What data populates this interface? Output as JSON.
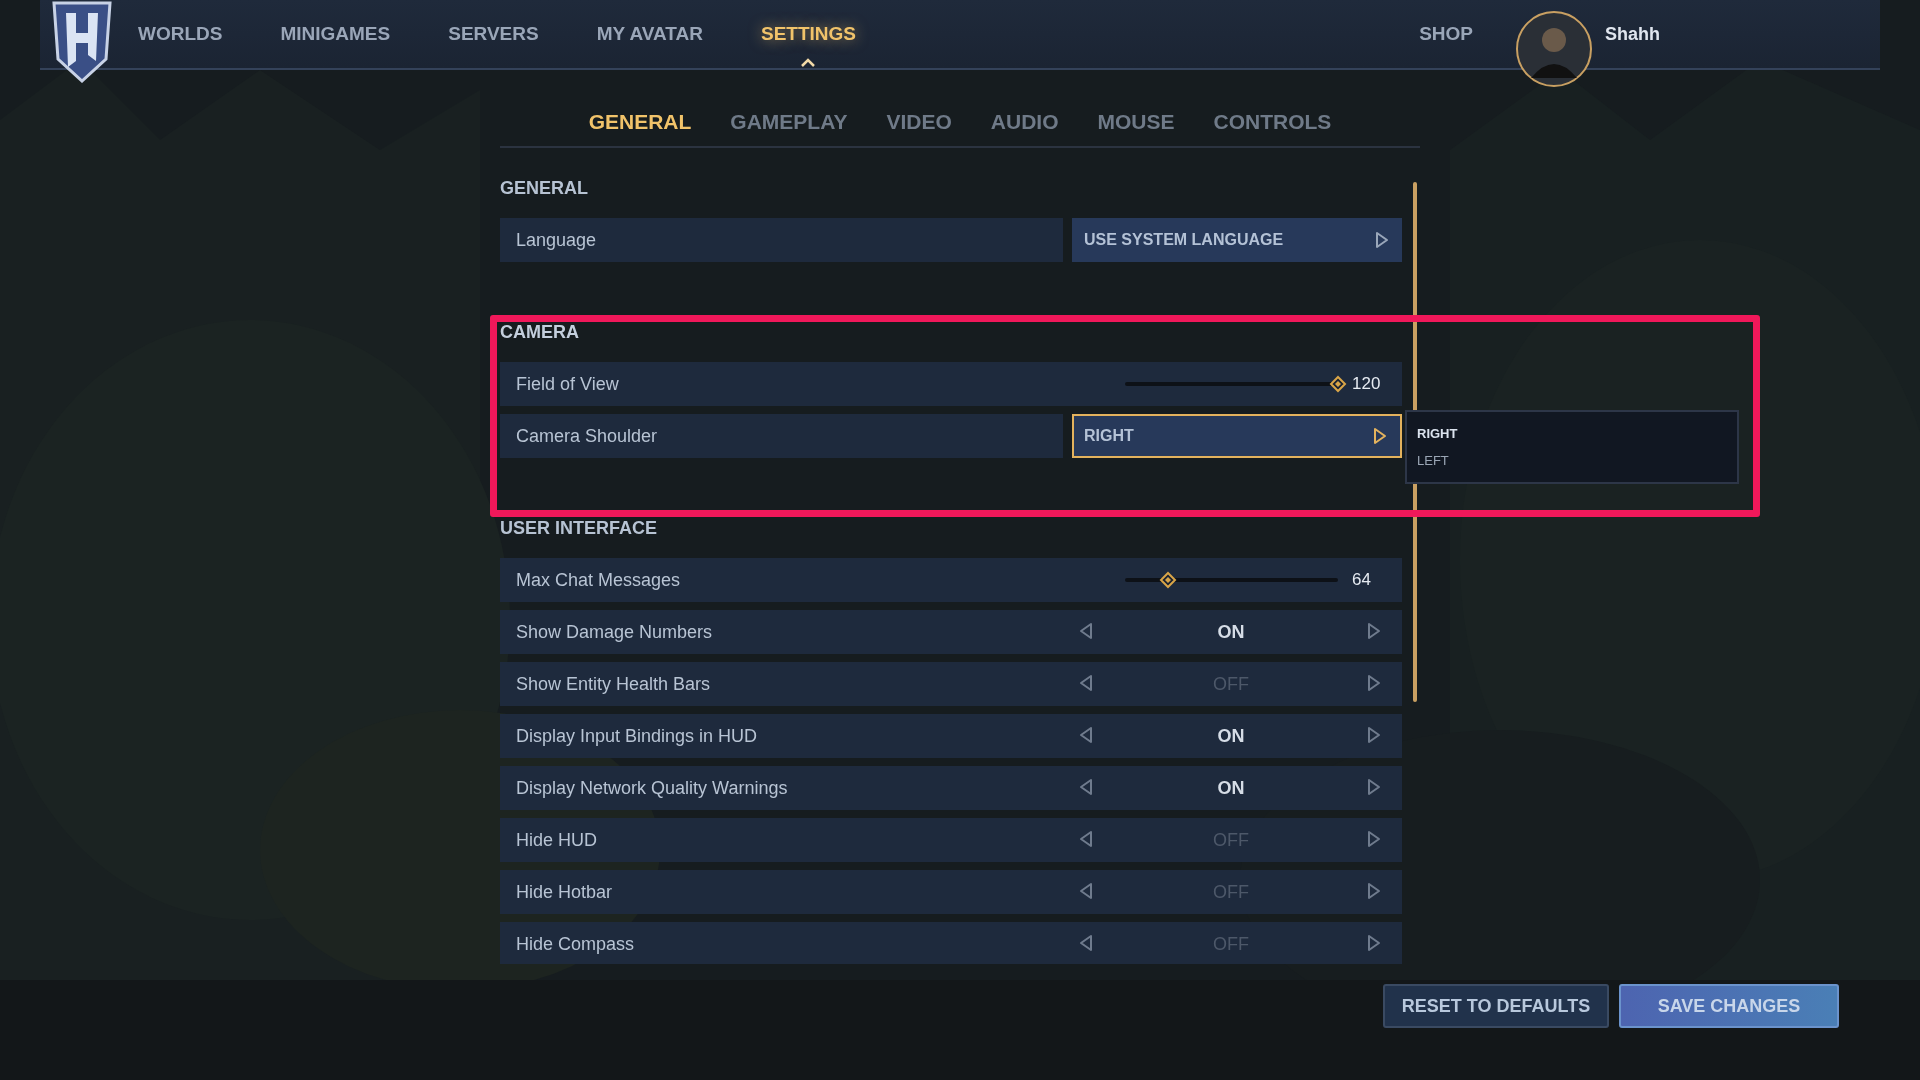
{
  "nav": {
    "items": [
      {
        "label": "WORLDS",
        "selected": false
      },
      {
        "label": "MINIGAMES",
        "selected": false
      },
      {
        "label": "SERVERS",
        "selected": false
      },
      {
        "label": "MY AVATAR",
        "selected": false
      },
      {
        "label": "SETTINGS",
        "selected": true
      }
    ],
    "shop": "SHOP",
    "user": "Shahh"
  },
  "tabs": [
    {
      "label": "GENERAL",
      "selected": true
    },
    {
      "label": "GAMEPLAY",
      "selected": false
    },
    {
      "label": "VIDEO",
      "selected": false
    },
    {
      "label": "AUDIO",
      "selected": false
    },
    {
      "label": "MOUSE",
      "selected": false
    },
    {
      "label": "CONTROLS",
      "selected": false
    }
  ],
  "sections": [
    {
      "title": "GENERAL",
      "highlighted": false,
      "rows": [
        {
          "kind": "select",
          "label": "Language",
          "value": "USE SYSTEM LANGUAGE",
          "focused": false
        }
      ]
    },
    {
      "title": "CAMERA",
      "highlighted": true,
      "rows": [
        {
          "kind": "slider",
          "label": "Field of View",
          "level": 1,
          "reading": "120"
        },
        {
          "kind": "select",
          "label": "Camera Shoulder",
          "value": "RIGHT",
          "focused": true,
          "dropdown": [
            {
              "label": "RIGHT",
              "selected": true
            },
            {
              "label": "LEFT",
              "selected": false
            }
          ]
        }
      ]
    },
    {
      "title": "USER INTERFACE",
      "highlighted": false,
      "rows": [
        {
          "kind": "slider",
          "label": "Max Chat Messages",
          "level": 0.2,
          "reading": "64"
        },
        {
          "kind": "toggle",
          "label": "Show Damage Numbers",
          "value": "ON",
          "on": true
        },
        {
          "kind": "toggle",
          "label": "Show Entity Health Bars",
          "value": "OFF",
          "on": false
        },
        {
          "kind": "toggle",
          "label": "Display Input Bindings in HUD",
          "value": "ON",
          "on": true
        },
        {
          "kind": "toggle",
          "label": "Display Network Quality Warnings",
          "value": "ON",
          "on": true
        },
        {
          "kind": "toggle",
          "label": "Hide HUD",
          "value": "OFF",
          "on": false
        },
        {
          "kind": "toggle",
          "label": "Hide Hotbar",
          "value": "OFF",
          "on": false
        },
        {
          "kind": "toggle",
          "label": "Hide Compass",
          "value": "OFF",
          "on": false
        }
      ]
    }
  ],
  "buttons": {
    "reset": "RESET TO DEFAULTS",
    "save": "SAVE CHANGES"
  }
}
